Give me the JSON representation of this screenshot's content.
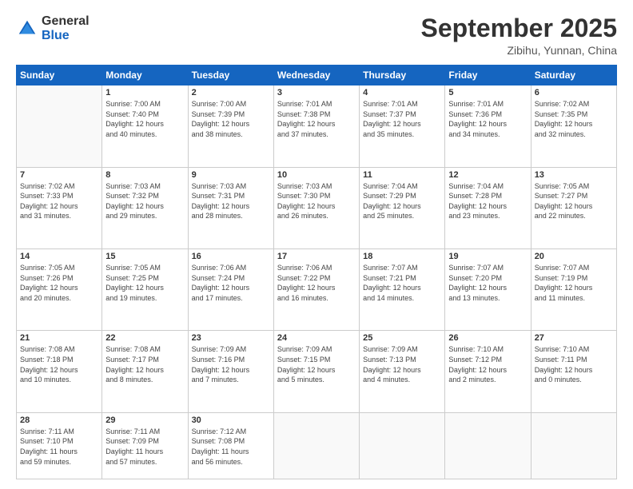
{
  "logo": {
    "general": "General",
    "blue": "Blue"
  },
  "title": {
    "main": "September 2025",
    "sub": "Zibihu, Yunnan, China"
  },
  "weekdays": [
    "Sunday",
    "Monday",
    "Tuesday",
    "Wednesday",
    "Thursday",
    "Friday",
    "Saturday"
  ],
  "weeks": [
    [
      {
        "day": "",
        "info": ""
      },
      {
        "day": "1",
        "info": "Sunrise: 7:00 AM\nSunset: 7:40 PM\nDaylight: 12 hours\nand 40 minutes."
      },
      {
        "day": "2",
        "info": "Sunrise: 7:00 AM\nSunset: 7:39 PM\nDaylight: 12 hours\nand 38 minutes."
      },
      {
        "day": "3",
        "info": "Sunrise: 7:01 AM\nSunset: 7:38 PM\nDaylight: 12 hours\nand 37 minutes."
      },
      {
        "day": "4",
        "info": "Sunrise: 7:01 AM\nSunset: 7:37 PM\nDaylight: 12 hours\nand 35 minutes."
      },
      {
        "day": "5",
        "info": "Sunrise: 7:01 AM\nSunset: 7:36 PM\nDaylight: 12 hours\nand 34 minutes."
      },
      {
        "day": "6",
        "info": "Sunrise: 7:02 AM\nSunset: 7:35 PM\nDaylight: 12 hours\nand 32 minutes."
      }
    ],
    [
      {
        "day": "7",
        "info": "Sunrise: 7:02 AM\nSunset: 7:33 PM\nDaylight: 12 hours\nand 31 minutes."
      },
      {
        "day": "8",
        "info": "Sunrise: 7:03 AM\nSunset: 7:32 PM\nDaylight: 12 hours\nand 29 minutes."
      },
      {
        "day": "9",
        "info": "Sunrise: 7:03 AM\nSunset: 7:31 PM\nDaylight: 12 hours\nand 28 minutes."
      },
      {
        "day": "10",
        "info": "Sunrise: 7:03 AM\nSunset: 7:30 PM\nDaylight: 12 hours\nand 26 minutes."
      },
      {
        "day": "11",
        "info": "Sunrise: 7:04 AM\nSunset: 7:29 PM\nDaylight: 12 hours\nand 25 minutes."
      },
      {
        "day": "12",
        "info": "Sunrise: 7:04 AM\nSunset: 7:28 PM\nDaylight: 12 hours\nand 23 minutes."
      },
      {
        "day": "13",
        "info": "Sunrise: 7:05 AM\nSunset: 7:27 PM\nDaylight: 12 hours\nand 22 minutes."
      }
    ],
    [
      {
        "day": "14",
        "info": "Sunrise: 7:05 AM\nSunset: 7:26 PM\nDaylight: 12 hours\nand 20 minutes."
      },
      {
        "day": "15",
        "info": "Sunrise: 7:05 AM\nSunset: 7:25 PM\nDaylight: 12 hours\nand 19 minutes."
      },
      {
        "day": "16",
        "info": "Sunrise: 7:06 AM\nSunset: 7:24 PM\nDaylight: 12 hours\nand 17 minutes."
      },
      {
        "day": "17",
        "info": "Sunrise: 7:06 AM\nSunset: 7:22 PM\nDaylight: 12 hours\nand 16 minutes."
      },
      {
        "day": "18",
        "info": "Sunrise: 7:07 AM\nSunset: 7:21 PM\nDaylight: 12 hours\nand 14 minutes."
      },
      {
        "day": "19",
        "info": "Sunrise: 7:07 AM\nSunset: 7:20 PM\nDaylight: 12 hours\nand 13 minutes."
      },
      {
        "day": "20",
        "info": "Sunrise: 7:07 AM\nSunset: 7:19 PM\nDaylight: 12 hours\nand 11 minutes."
      }
    ],
    [
      {
        "day": "21",
        "info": "Sunrise: 7:08 AM\nSunset: 7:18 PM\nDaylight: 12 hours\nand 10 minutes."
      },
      {
        "day": "22",
        "info": "Sunrise: 7:08 AM\nSunset: 7:17 PM\nDaylight: 12 hours\nand 8 minutes."
      },
      {
        "day": "23",
        "info": "Sunrise: 7:09 AM\nSunset: 7:16 PM\nDaylight: 12 hours\nand 7 minutes."
      },
      {
        "day": "24",
        "info": "Sunrise: 7:09 AM\nSunset: 7:15 PM\nDaylight: 12 hours\nand 5 minutes."
      },
      {
        "day": "25",
        "info": "Sunrise: 7:09 AM\nSunset: 7:13 PM\nDaylight: 12 hours\nand 4 minutes."
      },
      {
        "day": "26",
        "info": "Sunrise: 7:10 AM\nSunset: 7:12 PM\nDaylight: 12 hours\nand 2 minutes."
      },
      {
        "day": "27",
        "info": "Sunrise: 7:10 AM\nSunset: 7:11 PM\nDaylight: 12 hours\nand 0 minutes."
      }
    ],
    [
      {
        "day": "28",
        "info": "Sunrise: 7:11 AM\nSunset: 7:10 PM\nDaylight: 11 hours\nand 59 minutes."
      },
      {
        "day": "29",
        "info": "Sunrise: 7:11 AM\nSunset: 7:09 PM\nDaylight: 11 hours\nand 57 minutes."
      },
      {
        "day": "30",
        "info": "Sunrise: 7:12 AM\nSunset: 7:08 PM\nDaylight: 11 hours\nand 56 minutes."
      },
      {
        "day": "",
        "info": ""
      },
      {
        "day": "",
        "info": ""
      },
      {
        "day": "",
        "info": ""
      },
      {
        "day": "",
        "info": ""
      }
    ]
  ]
}
